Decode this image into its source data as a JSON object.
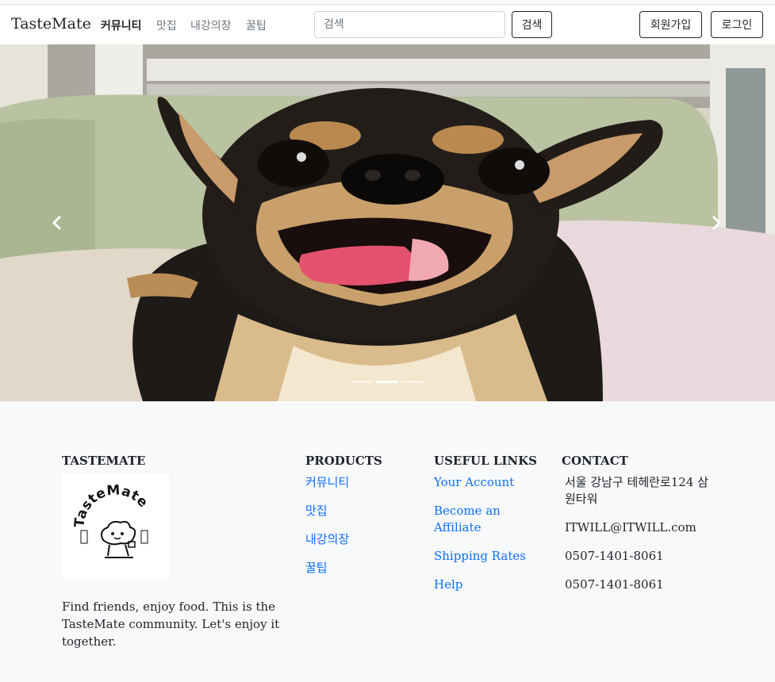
{
  "navbar": {
    "brand": "TasteMate",
    "links": [
      "커뮤니티",
      "맛집",
      "내강의장",
      "꿀팁"
    ],
    "search_placeholder": "검색",
    "search_button": "검색",
    "signup_button": "회원가입",
    "login_button": "로그인"
  },
  "carousel": {
    "slide_count": 3,
    "active_index": 1,
    "prev_icon": "chevron-left-icon",
    "next_icon": "chevron-right-icon"
  },
  "footer": {
    "brand": {
      "heading": "TASTEMATE",
      "logo_text": "TasteMate",
      "description": "Find friends, enjoy food. This is the TasteMate community. Let's enjoy it together."
    },
    "products": {
      "heading": "PRODUCTS",
      "items": [
        "커뮤니티",
        "맛집",
        "내강의장",
        "꿀팁"
      ]
    },
    "useful_links": {
      "heading": "USEFUL LINKS",
      "items": [
        "Your Account",
        "Become an Affiliate",
        "Shipping Rates",
        "Help"
      ]
    },
    "contact": {
      "heading": "CONTACT",
      "address": "서울 강남구 테헤란로124 삼원타워",
      "email": "ITWILL@ITWILL.com",
      "phone1": "0507-1401-8061",
      "phone2": "0507-1401-8061"
    }
  },
  "colors": {
    "link": "#0d6efd",
    "footer_bg": "#f8f9fa",
    "text": "#212529"
  }
}
